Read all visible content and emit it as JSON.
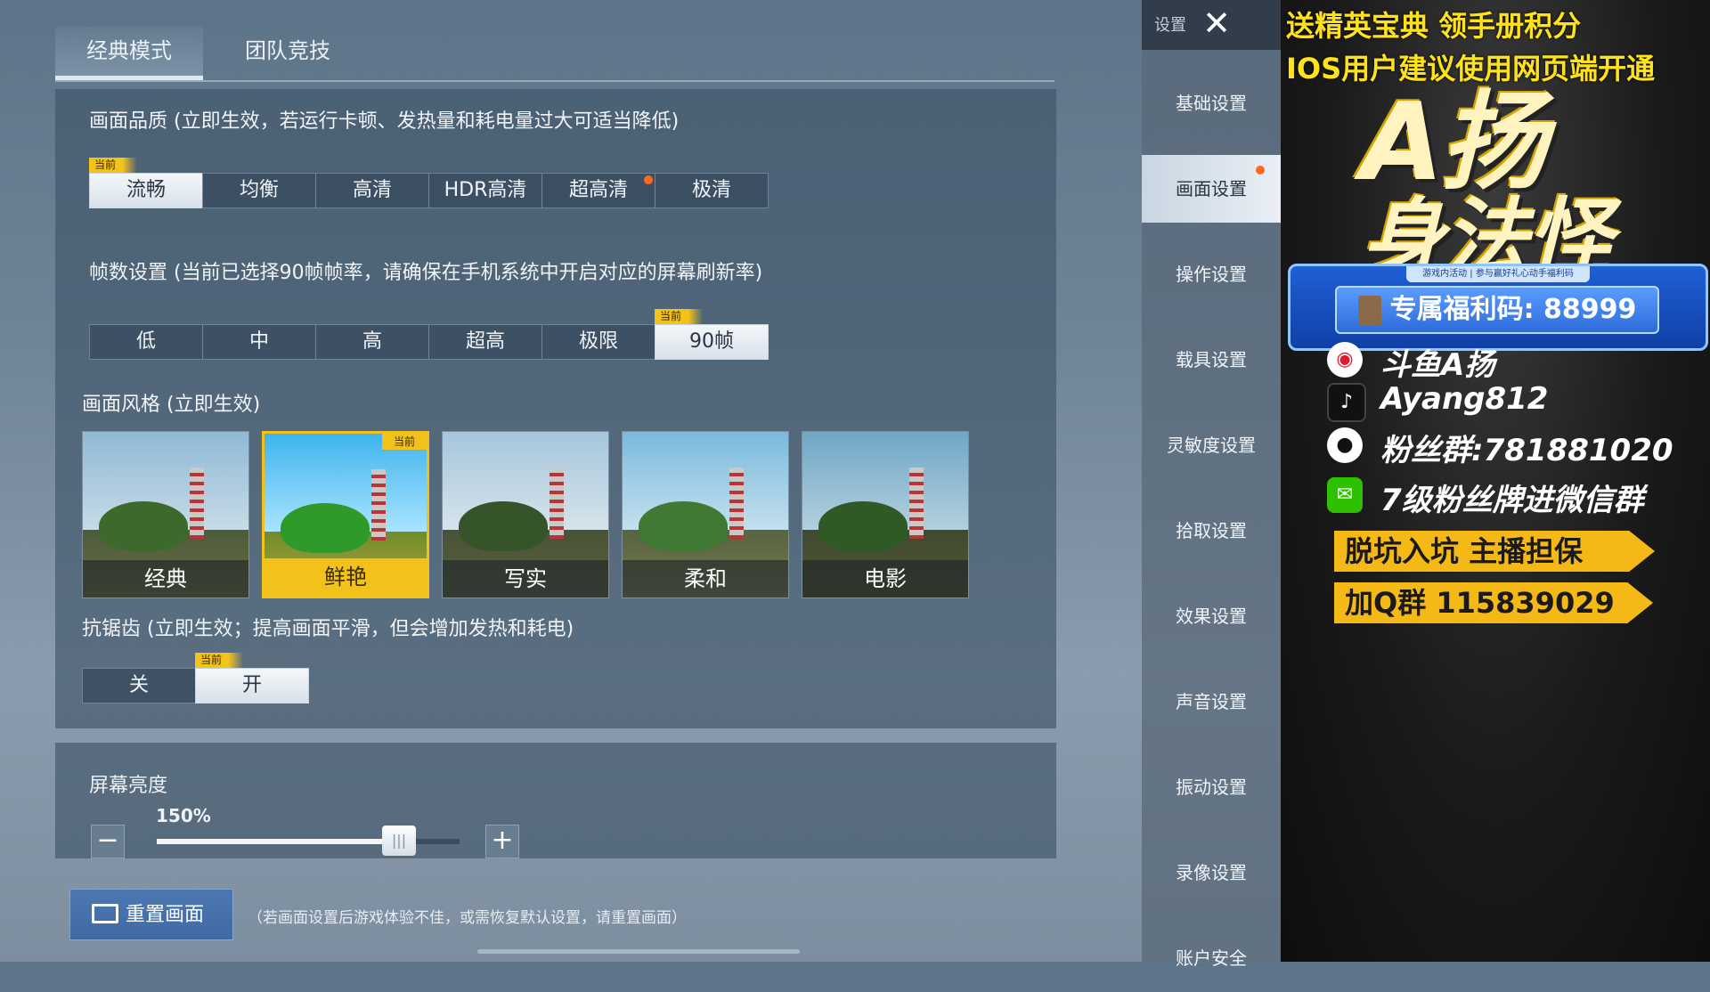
{
  "tabs": [
    "经典模式",
    "团队竞技"
  ],
  "quality": {
    "title": "画面品质 (立即生效，若运行卡顿、发热量和耗电量过大可适当降低)",
    "current_tag": "当前",
    "options": [
      "流畅",
      "均衡",
      "高清",
      "HDR高清",
      "超高清",
      "极清"
    ],
    "selected": "流畅",
    "new_dot_on": "超高清"
  },
  "fps": {
    "title": "帧数设置 (当前已选择90帧帧率，请确保在手机系统中开启对应的屏幕刷新率)",
    "current_tag": "当前",
    "options": [
      "低",
      "中",
      "高",
      "超高",
      "极限",
      "90帧"
    ],
    "selected": "90帧"
  },
  "style": {
    "title": "画面风格 (立即生效)",
    "current_tag": "当前",
    "options": [
      "经典",
      "鲜艳",
      "写实",
      "柔和",
      "电影"
    ],
    "selected": "鲜艳"
  },
  "antialias": {
    "title": "抗锯齿 (立即生效；提高画面平滑，但会增加发热和耗电)",
    "current_tag": "当前",
    "options": [
      "关",
      "开"
    ],
    "selected": "开"
  },
  "brightness": {
    "title": "屏幕亮度",
    "value_text": "150%",
    "level_fraction": 0.8,
    "minus_label": "−",
    "plus_label": "+",
    "knob_label": "|||"
  },
  "reset": {
    "button_label": "重置画面",
    "hint": "（若画面设置后游戏体验不佳，或需恢复默认设置，请重置画面）"
  },
  "nav": {
    "header_label": "设置",
    "close_icon": "close-icon",
    "items": [
      "基础设置",
      "画面设置",
      "操作设置",
      "载具设置",
      "灵敏度设置",
      "拾取设置",
      "效果设置",
      "声音设置",
      "振动设置",
      "录像设置",
      "账户安全"
    ],
    "selected": "画面设置"
  },
  "overlay": {
    "line1": "送精英宝典 领手册积分",
    "line2": "IOS用户建议使用网页端开通",
    "title_big1": "A扬",
    "title_big2": "身法怪",
    "code_sub": "游戏内活动 | 参与赢好礼心动手福利码",
    "code_text": "专属福利码: 88999",
    "socials": [
      {
        "icon": "weibo-icon",
        "text": "斗鱼A扬"
      },
      {
        "icon": "tiktok-icon",
        "text": "Ayang812"
      },
      {
        "icon": "qq-icon",
        "text": "粉丝群:781881020"
      },
      {
        "icon": "wechat-icon",
        "text": "7级粉丝牌进微信群"
      }
    ],
    "banner1": "脱坑入坑 主播担保",
    "banner2": "加Q群 115839029"
  },
  "colors": {
    "accent_gold": "#f2c21a",
    "new_dot": "#ff6a1a",
    "reset_blue": "#4d78b3"
  }
}
